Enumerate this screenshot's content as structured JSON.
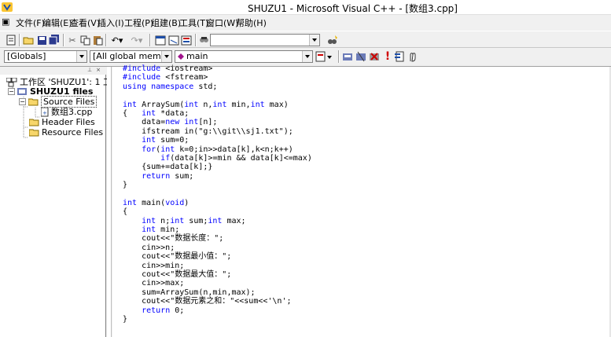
{
  "window": {
    "title": "SHUZU1 - Microsoft Visual C++ - [数组3.cpp]"
  },
  "menu": [
    "文件(F)",
    "编辑(E)",
    "查看(V)",
    "插入(I)",
    "工程(P)",
    "组建(B)",
    "工具(T)",
    "窗口(W)",
    "帮助(H)"
  ],
  "toolbar": {
    "search_value": "",
    "icons": [
      "new-file-icon",
      "open-icon",
      "save-icon",
      "save-all-icon",
      "cut-icon",
      "copy-icon",
      "paste-icon",
      "undo-icon",
      "redo-icon",
      "workspace-icon",
      "output-icon",
      "window-list-icon",
      "find-in-files-icon",
      "find-icon"
    ]
  },
  "wizardbar": {
    "class_combo": "[Globals]",
    "filter_combo": "[All global members",
    "member_combo": "main",
    "icons": [
      "wizard-action-icon",
      "compile-icon",
      "build-icon",
      "stop-build-icon",
      "execute-icon",
      "insert-breakpoint-icon",
      "go-icon"
    ]
  },
  "workspace": {
    "root": "工作区 'SHUZU1': 1 工",
    "project": "SHUZU1 files",
    "source_folder": "Source Files",
    "source_file": "数组3.cpp",
    "header_folder": "Header Files",
    "resource_folder": "Resource Files"
  },
  "code_lines": [
    "#include <iostream>",
    "#include <fstream>",
    "using namespace std;",
    "",
    "int ArraySum(int n,int min,int max)",
    "{   int *data;",
    "    data=new int[n];",
    "    ifstream in(\"g:\\\\git\\\\sj1.txt\");",
    "    int sum=0;",
    "    for(int k=0;in>>data[k],k<n;k++)",
    "        if(data[k]>=min && data[k]<=max)",
    "    {sum+=data[k];}",
    "    return sum;",
    "}",
    "",
    "int main(void)",
    "{",
    "    int n;int sum;int max;",
    "    int min;",
    "    cout<<\"数据长度：\";",
    "    cin>>n;",
    "    cout<<\"数据最小值：\";",
    "    cin>>min;",
    "    cout<<\"数据最大值：\";",
    "    cin>>max;",
    "    sum=ArraySum(n,min,max);",
    "    cout<<\"数据元素之和：\"<<sum<<'\\n';",
    "    return 0;",
    "}"
  ],
  "keywords": [
    "#include",
    "using",
    "namespace",
    "int",
    "new",
    "for",
    "if",
    "return",
    "void"
  ]
}
